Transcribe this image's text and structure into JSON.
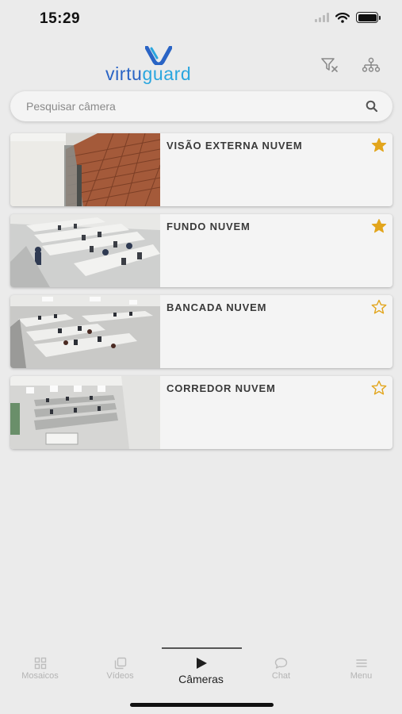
{
  "status_bar": {
    "time": "15:29"
  },
  "header": {
    "logo_part1": "virtu",
    "logo_part2": "guard",
    "filter_clear_icon": "filter-clear-icon",
    "hierarchy_icon": "hierarchy-icon"
  },
  "search": {
    "placeholder": "Pesquisar câmera",
    "value": ""
  },
  "cameras": [
    {
      "name": "VISÃO EXTERNA NUVEM",
      "favorite": true
    },
    {
      "name": "FUNDO NUVEM",
      "favorite": true
    },
    {
      "name": "BANCADA NUVEM",
      "favorite": false
    },
    {
      "name": "CORREDOR NUVEM",
      "favorite": false
    }
  ],
  "tabs": [
    {
      "label": "Mosaicos",
      "icon": "grid-icon",
      "active": false
    },
    {
      "label": "Vídeos",
      "icon": "videos-icon",
      "active": false
    },
    {
      "label": "Câmeras",
      "icon": "play-icon",
      "active": true
    },
    {
      "label": "Chat",
      "icon": "chat-icon",
      "active": false
    },
    {
      "label": "Menu",
      "icon": "menu-icon",
      "active": false
    }
  ],
  "colors": {
    "star": "#e2a51c",
    "logo_dark": "#2a64c5",
    "logo_light": "#2aa6df",
    "background": "#ebebeb"
  }
}
